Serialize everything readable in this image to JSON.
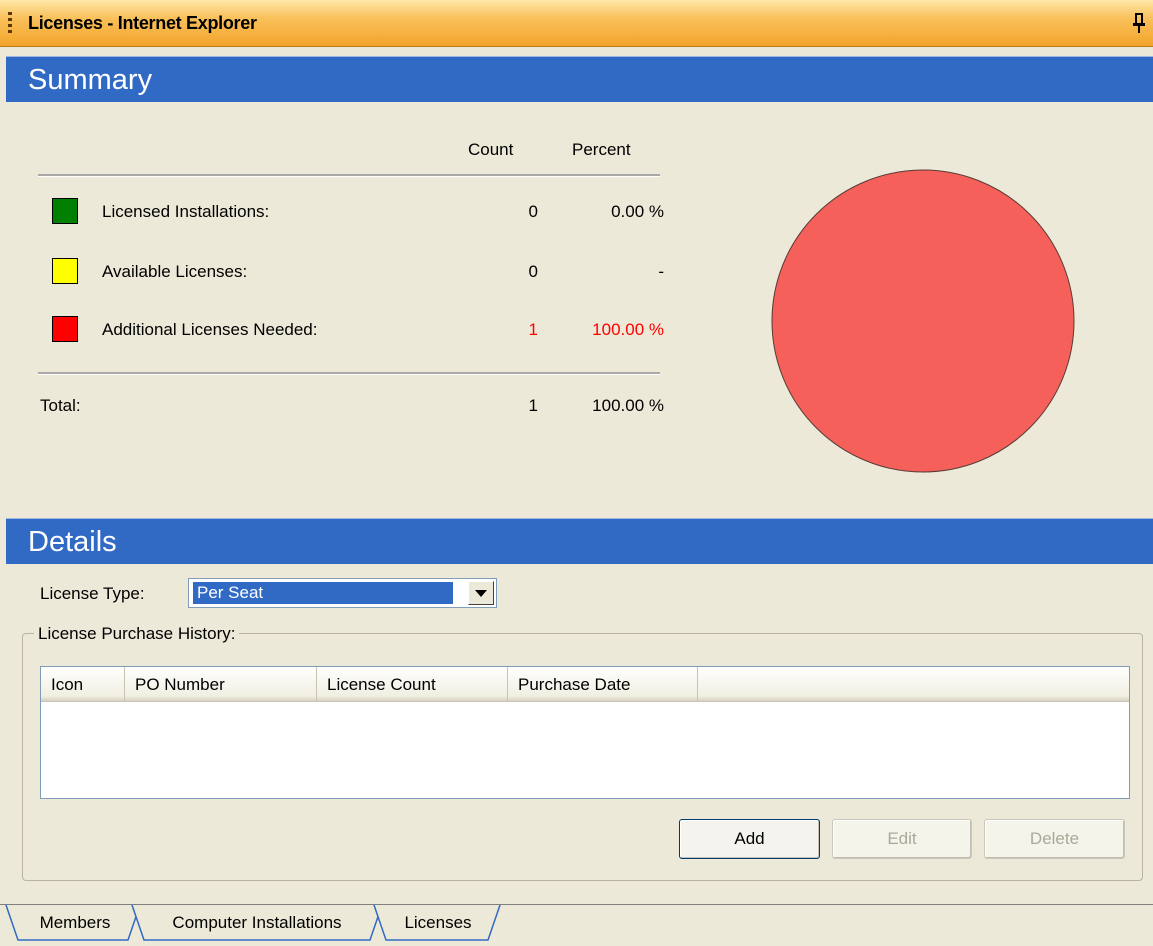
{
  "window": {
    "title": "Licenses - Internet Explorer"
  },
  "summary": {
    "header": "Summary",
    "columns": {
      "count": "Count",
      "percent": "Percent"
    },
    "rows": [
      {
        "label": "Licensed Installations:",
        "count": "0",
        "percent": "0.00 %",
        "color": "#007f00"
      },
      {
        "label": "Available Licenses:",
        "count": "0",
        "percent": "-",
        "color": "#ffff00"
      },
      {
        "label": "Additional Licenses Needed:",
        "count": "1",
        "percent": "100.00 %",
        "color": "#ff0000",
        "highlight": "#ff0000"
      }
    ],
    "total": {
      "label": "Total:",
      "count": "1",
      "percent": "100.00 %"
    }
  },
  "chart_data": {
    "type": "pie",
    "slices": [
      {
        "label": "Licensed Installations",
        "value": 0,
        "color": "#007f00"
      },
      {
        "label": "Available Licenses",
        "value": 0,
        "color": "#ffff00"
      },
      {
        "label": "Additional Licenses Needed",
        "value": 1,
        "color": "#f5615a"
      }
    ]
  },
  "details": {
    "header": "Details",
    "license_type_label": "License Type:",
    "license_type_value": "Per Seat",
    "purchase_history_label": "License Purchase History:",
    "columns": [
      "Icon",
      "PO Number",
      "License Count",
      "Purchase Date"
    ],
    "rows": [],
    "buttons": {
      "add": "Add",
      "edit": "Edit",
      "delete": "Delete"
    }
  },
  "tabs": [
    {
      "label": "Members",
      "active": false
    },
    {
      "label": "Computer Installations",
      "active": false
    },
    {
      "label": "Licenses",
      "active": true
    }
  ],
  "colors": {
    "title_bar": "#f9c05a",
    "section_header": "#316ac5",
    "background": "#ece9d8"
  }
}
